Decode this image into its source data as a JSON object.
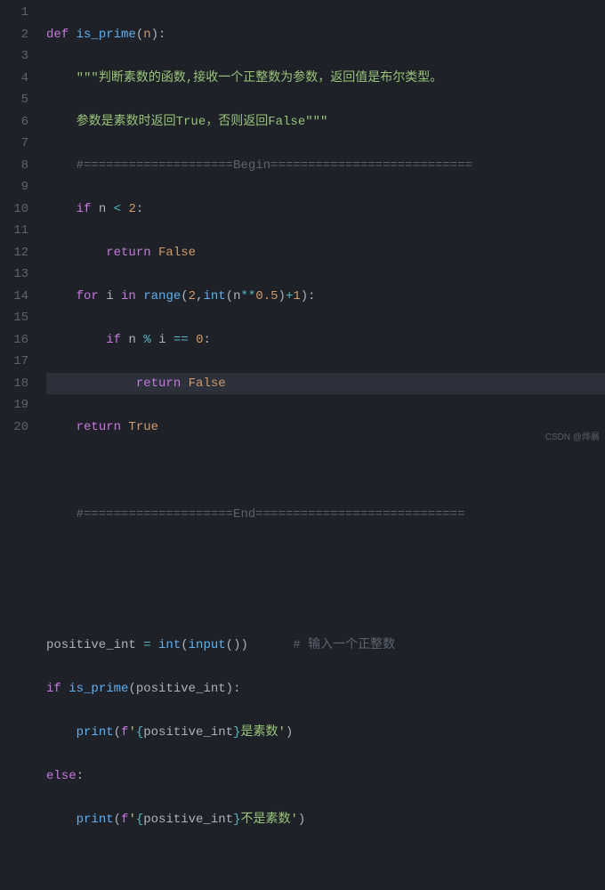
{
  "colors": {
    "background": "#1e2127",
    "gutter_fg": "#5c6370",
    "default": "#abb2bf",
    "keyword": "#c678dd",
    "function": "#61afef",
    "number": "#d19a66",
    "operator": "#56b6c2",
    "string": "#98c379",
    "comment": "#5c6370",
    "line_highlight": "#2c313c"
  },
  "gutter_numbers": [
    "1",
    "2",
    "3",
    "4",
    "5",
    "6",
    "7",
    "8",
    "9",
    "10",
    "11",
    "12",
    "13",
    "14",
    "15",
    "16",
    "17",
    "18",
    "19",
    "20"
  ],
  "highlighted_line": 9,
  "code_plain": "def is_prime(n):\n    \"\"\"判断素数的函数,接收一个正整数为参数，返回值是布尔类型。\n    参数是素数时返回True，否则返回False\"\"\"\n    #====================Begin===========================\n    if n < 2:\n        return False\n    for i in range(2,int(n**0.5)+1):\n        if n % i == 0:\n            return False\n    return True\n\n    #====================End============================\n\n\npositive_int = int(input())      # 输入一个正整数\nif is_prime(positive_int):\n    print(f'{positive_int}是素数')\nelse:\n    print(f'{positive_int}不是素数')\n",
  "tokens": {
    "l1_def": "def ",
    "l1_fn": "is_prime",
    "l1_paren_o": "(",
    "l1_param": "n",
    "l1_paren_c": "):",
    "l2_doc": "\"\"\"判断素数的函数,接收一个正整数为参数，返回值是布尔类型。",
    "l3_doc": "参数是素数时返回True，否则返回False\"\"\"",
    "l4_c": "#====================Begin===========================",
    "l5_if": "if ",
    "l5_n": "n ",
    "l5_op": "< ",
    "l5_num": "2",
    "l5_colon": ":",
    "l6_ret": "return ",
    "l6_false": "False",
    "l7_for": "for ",
    "l7_i": "i ",
    "l7_in": "in ",
    "l7_range": "range",
    "l7_po": "(",
    "l7_2": "2",
    "l7_comma": ",",
    "l7_int": "int",
    "l7_po2": "(",
    "l7_n": "n",
    "l7_pow": "**",
    "l7_05": "0.5",
    "l7_pc2": ")",
    "l7_plus": "+",
    "l7_1": "1",
    "l7_pc": "):",
    "l8_if": "if ",
    "l8_n": "n ",
    "l8_mod": "% ",
    "l8_i": "i ",
    "l8_eq": "== ",
    "l8_0": "0",
    "l8_colon": ":",
    "l9_ret": "return ",
    "l9_false": "False",
    "l10_ret": "return ",
    "l10_true": "True",
    "l12_c": "#====================End============================",
    "l15_var": "positive_int ",
    "l15_eq": "= ",
    "l15_int": "int",
    "l15_po": "(",
    "l15_input": "input",
    "l15_pc": "())",
    "l15_sp": "      ",
    "l15_c": "# 输入一个正整数",
    "l16_if": "if ",
    "l16_fn": "is_prime",
    "l16_po": "(",
    "l16_arg": "positive_int",
    "l16_pc": "):",
    "l17_print": "print",
    "l17_po": "(",
    "l17_f": "f",
    "l17_s1": "'",
    "l17_br_o": "{",
    "l17_var": "positive_int",
    "l17_br_c": "}",
    "l17_txt": "是素数",
    "l17_s2": "'",
    "l17_pc": ")",
    "l18_else": "else",
    "l18_colon": ":",
    "l19_print": "print",
    "l19_po": "(",
    "l19_f": "f",
    "l19_s1": "'",
    "l19_br_o": "{",
    "l19_var": "positive_int",
    "l19_br_c": "}",
    "l19_txt": "不是素数",
    "l19_s2": "'",
    "l19_pc": ")"
  },
  "watermark": "CSDN @烨晨"
}
